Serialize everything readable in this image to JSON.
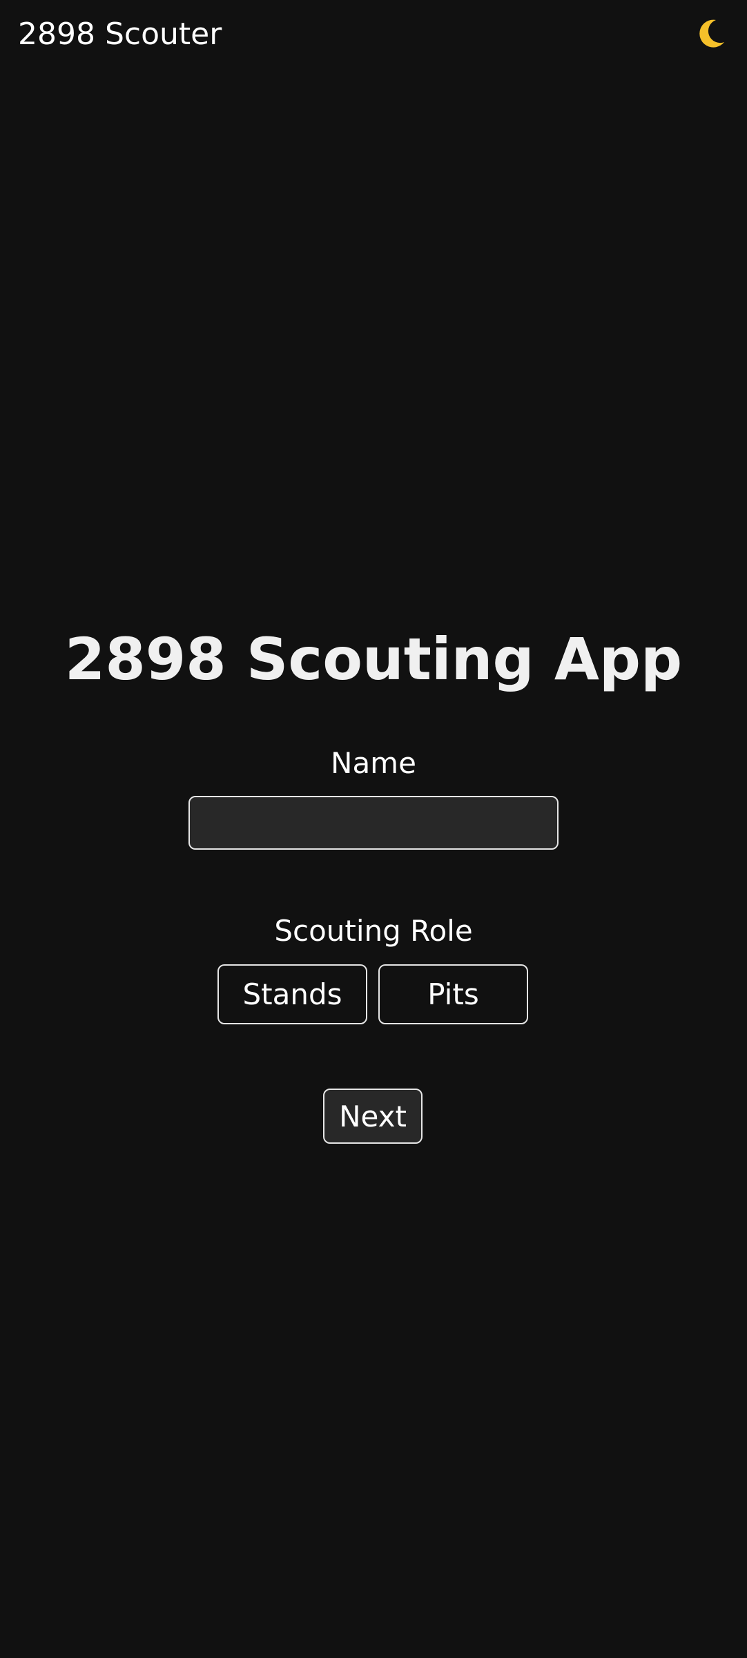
{
  "header": {
    "app_title": "2898 Scouter",
    "theme_toggle_icon": "moon-icon",
    "theme_toggle_color": "#F5C02A"
  },
  "main": {
    "heading": "2898 Scouting App",
    "name_label": "Name",
    "name_value": "",
    "name_placeholder": "",
    "role_label": "Scouting Role",
    "roles": [
      {
        "label": "Stands"
      },
      {
        "label": "Pits"
      }
    ],
    "next_label": "Next"
  },
  "colors": {
    "background": "#111111",
    "input_background": "#282828",
    "border": "#E6E6E6",
    "text": "#FFFFFF"
  }
}
